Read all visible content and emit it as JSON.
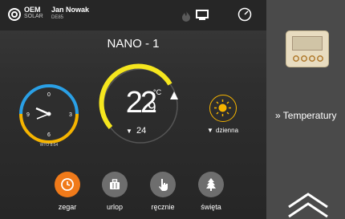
{
  "header": {
    "brand_line1": "OEM",
    "brand_line2": "SOLAR",
    "user_name": "Jan Nowak",
    "user_code": "DE85",
    "title": "NANO - 1"
  },
  "clock": {
    "caption": "WTO 8:54",
    "hours": "8",
    "minutes": "54"
  },
  "thermostat": {
    "temperature_int": "22",
    "temperature_dec": "9",
    "unit": "°C",
    "setpoint": "24",
    "setpoint_arrow": "▼"
  },
  "mode": {
    "arrow": "▼",
    "label": "dzienna"
  },
  "bottom_buttons": [
    {
      "label": "zegar",
      "icon": "clock-icon",
      "active": true
    },
    {
      "label": "urlop",
      "icon": "suitcase-icon",
      "active": false
    },
    {
      "label": "ręcznie",
      "icon": "hand-icon",
      "active": false
    },
    {
      "label": "święta",
      "icon": "christmas-tree-icon",
      "active": false
    }
  ],
  "side_panel": {
    "label": "» Temperatury"
  },
  "colors": {
    "accent_orange": "#f07a1a",
    "ring_yellow": "#f5e61e",
    "clock_blue": "#2aa0e6",
    "clock_yellow": "#f5b400",
    "button_grey": "#6e6e6e",
    "thermostat_face": "#e8dcc0"
  }
}
